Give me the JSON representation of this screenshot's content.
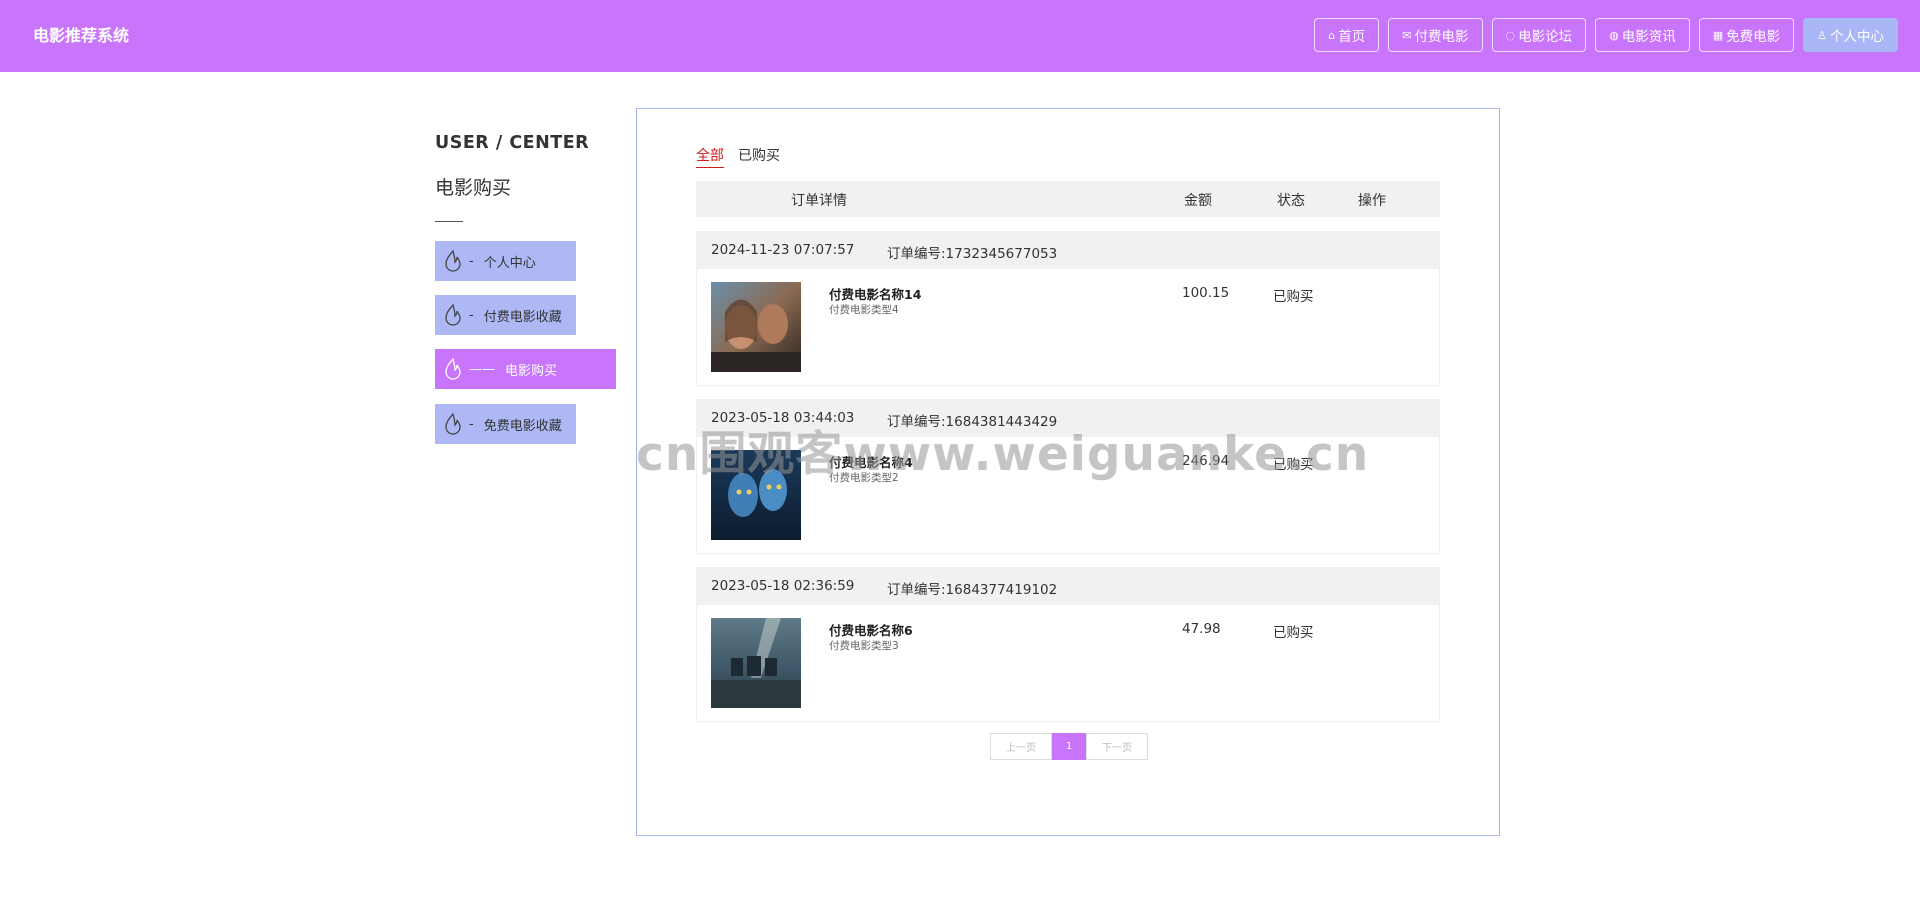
{
  "header": {
    "brand": "电影推荐系统",
    "nav": [
      {
        "icon": "home-icon",
        "label": "首页"
      },
      {
        "icon": "mail-icon",
        "label": "付费电影"
      },
      {
        "icon": "chat-icon",
        "label": "电影论坛"
      },
      {
        "icon": "globe-icon",
        "label": "电影资讯"
      },
      {
        "icon": "film-icon",
        "label": "免费电影"
      },
      {
        "icon": "user-icon",
        "label": "个人中心"
      }
    ]
  },
  "sidebar": {
    "title": "USER / CENTER",
    "subtitle": "电影购买",
    "items": [
      {
        "dash": "-",
        "label": "个人中心"
      },
      {
        "dash": "-",
        "label": "付费电影收藏"
      },
      {
        "dash": "——",
        "label": "电影购买"
      },
      {
        "dash": "-",
        "label": "免费电影收藏"
      }
    ]
  },
  "tabs": [
    "全部",
    "已购买"
  ],
  "table": {
    "headers": {
      "detail": "订单详情",
      "amount": "金额",
      "status": "状态",
      "action": "操作"
    }
  },
  "orders": [
    {
      "time": "2024-11-23 07:07:57",
      "order_no": "订单编号:1732345677053",
      "name": "付费电影名称14",
      "type": "付费电影类型4",
      "amount": "100.15",
      "status": "已购买"
    },
    {
      "time": "2023-05-18 03:44:03",
      "order_no": "订单编号:1684381443429",
      "name": "付费电影名称4",
      "type": "付费电影类型2",
      "amount": "246.94",
      "status": "已购买"
    },
    {
      "time": "2023-05-18 02:36:59",
      "order_no": "订单编号:1684377419102",
      "name": "付费电影名称6",
      "type": "付费电影类型3",
      "amount": "47.98",
      "status": "已购买"
    }
  ],
  "pager": {
    "prev": "上一页",
    "current": "1",
    "next": "下一页"
  },
  "watermark": "cn围观客www.weiguanke.cn",
  "colors": {
    "accent": "#c874fb",
    "side_item": "#adb8f5",
    "panel_border": "#a7b4f0",
    "tab_active": "#d11b1b"
  }
}
